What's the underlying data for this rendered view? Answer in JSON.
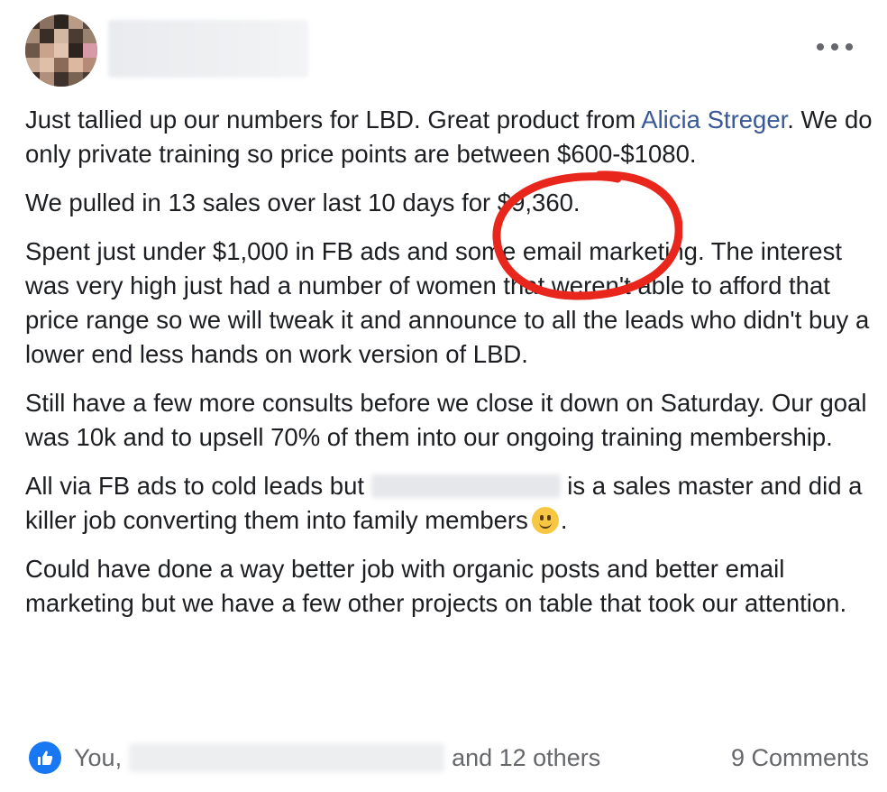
{
  "post": {
    "link_name": "Alicia Streger",
    "para1_pre": "Just tallied up our numbers for LBD. Great product from ",
    "para1_post": ". We do only private training so price points are between $600-$1080.",
    "para2": "We pulled in 13 sales over last 10 days for $9,360.",
    "para3": "Spent just under $1,000 in FB ads and some email marketing. The interest was very high just had a number of women that weren't able to afford that price range so we will tweak it and announce to all the leads who didn't buy a lower end less hands on work version of LBD.",
    "para4": "Still have a few more consults before we close it down on Saturday. Our goal was 10k and to upsell 70% of them into our ongoing training membership.",
    "para5_pre": "All via FB ads to cold leads but ",
    "para5_post": " is a sales master and did a killer job converting them into family members",
    "para5_end": ".",
    "para6": "Could have done a way better job with organic posts and better email marketing but we have a few other projects on table that took our attention."
  },
  "footer": {
    "you_label": "You,",
    "others_label": "and 12 others",
    "comments_label": "9 Comments"
  },
  "icons": {
    "more": "more-horizontal-icon",
    "like": "thumbs-up-icon",
    "emoji": "slightly-smiling-face-icon"
  },
  "colors": {
    "link": "#385898",
    "like_blue": "#1877f2",
    "annotation_red": "#e8261b"
  }
}
